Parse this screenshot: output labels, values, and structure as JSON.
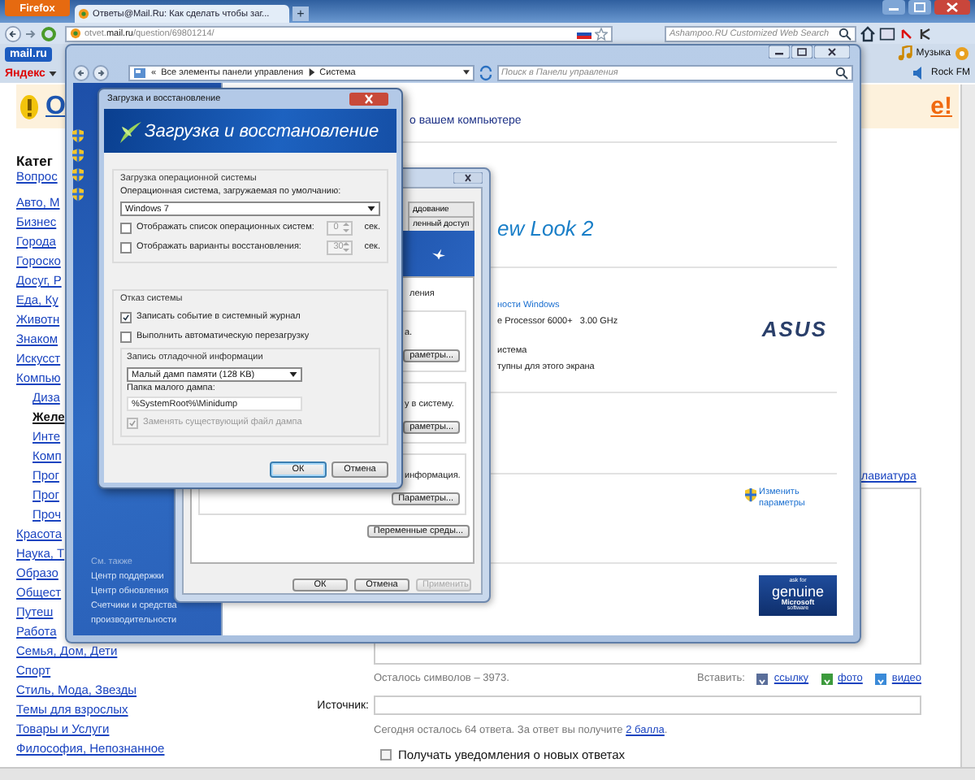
{
  "browser": {
    "menu_button": "Firefox",
    "tabs": [
      {
        "title": "Ответы@Mail.Ru: Как сделать чтобы заг...",
        "selected": true
      }
    ],
    "new_tab": "+",
    "url": "otvet.**mail.ru**/question/69801214/",
    "search_placeholder": "Ashampoo.RU Customized Web Search",
    "bookmarks_left": [
      "mail.ru",
      "Яндекс"
    ],
    "bookmarks_right": [
      "Музыка",
      "Rock FM"
    ]
  },
  "page": {
    "banner_link": "О",
    "banner_tail": "е!",
    "categories_heading": "Катег",
    "top_category": {
      "label": "Вопрос",
      "selected": false
    },
    "categories": [
      {
        "label": "Авто, М",
        "selected": false
      },
      {
        "label": "Бизнес",
        "selected": false
      },
      {
        "label": "Города",
        "selected": false
      },
      {
        "label": "Гороско",
        "selected": false
      },
      {
        "label": "Досуг, Р",
        "selected": false
      },
      {
        "label": "Еда, Ку",
        "selected": false
      },
      {
        "label": "Животн",
        "selected": false
      },
      {
        "label": "Знаком",
        "selected": false
      },
      {
        "label": "Искусст",
        "selected": false
      },
      {
        "label": "Компью",
        "selected": false,
        "children": [
          {
            "label": "Диза",
            "selected": false
          },
          {
            "label": "Желе",
            "selected": true
          },
          {
            "label": "Инте",
            "selected": false
          },
          {
            "label": "Комп",
            "selected": false
          },
          {
            "label": "Прог",
            "selected": false
          },
          {
            "label": "Прог",
            "selected": false
          },
          {
            "label": "Проч",
            "selected": false
          }
        ]
      },
      {
        "label": "Красота",
        "selected": false
      },
      {
        "label": "Наука, Т",
        "selected": false
      },
      {
        "label": "Образо",
        "selected": false
      },
      {
        "label": "Общест",
        "selected": false
      },
      {
        "label": "Путеш",
        "selected": false
      },
      {
        "label": "Работа",
        "selected": false
      },
      {
        "label": "Семья, Дом, Дети",
        "selected": false
      },
      {
        "label": "Спорт",
        "selected": false
      },
      {
        "label": "Стиль, Мода, Звезды",
        "selected": false
      },
      {
        "label": "Темы для взрослых",
        "selected": false
      },
      {
        "label": "Товары и Услуги",
        "selected": false
      },
      {
        "label": "Философия, Непознанное",
        "selected": false
      }
    ],
    "keyboard_link": "лавиатура",
    "chars_left": "Осталось символов – 3973.",
    "insert_label": "Вставить:",
    "insert_links": [
      {
        "kind": "link",
        "label": "ссылку"
      },
      {
        "kind": "photo",
        "label": "фото"
      },
      {
        "kind": "video",
        "label": "видео"
      }
    ],
    "source_label": "Источник:",
    "answers_note": {
      "before": "Сегодня осталось 64 ответа. За ответ вы получите ",
      "link": "2 балла",
      "after": "."
    },
    "notify": {
      "label": "Получать уведомления о новых ответах",
      "checked": false
    }
  },
  "control_panel": {
    "breadcrumb_prefix": "«",
    "breadcrumb": [
      "Все элементы панели управления",
      "Система"
    ],
    "search_placeholder": "Поиск в Панели управления",
    "see_also_heading": "См. также",
    "see_also": [
      "Центр поддержки",
      "Центр обновления",
      "Счетчики и средства производительности"
    ],
    "heading": "о вашем компьютере",
    "edition": "ew Look 2",
    "rating_link": "ности Windows",
    "processor": "e Processor 6000+   3.00 GHz",
    "system_type": "истема",
    "pen_touch": "тупны для этого экрана",
    "manufacturer_logo": "ASUS",
    "change_settings": "Изменить параметры",
    "genuine_badge": [
      "ask for",
      "genuine",
      "Microsoft",
      "software"
    ]
  },
  "system_properties": {
    "tabs": [
      {
        "label": "ддование",
        "selected": false
      },
      {
        "label": "ленный доступ",
        "selected": false
      }
    ],
    "intro": "ления",
    "sections": [
      {
        "text": "а.",
        "button": "раметры..."
      },
      {
        "text": "у в систему.",
        "button": "раметры..."
      },
      {
        "text": "информация.",
        "button": "Параметры..."
      }
    ],
    "env_button": "Переменные среды...",
    "buttons": [
      {
        "label": "ОК",
        "disabled": false
      },
      {
        "label": "Отмена",
        "disabled": false
      },
      {
        "label": "Применить",
        "disabled": true
      }
    ]
  },
  "boot_dialog": {
    "title": "Загрузка и восстановление",
    "banner": "Загрузка и восстановление",
    "startup": {
      "heading": "Загрузка операционной системы",
      "default_os_label": "Операционная система, загружаемая по умолчанию:",
      "default_os": "Windows 7",
      "options": [
        {
          "label": "Отображать список операционных систем:",
          "checked": false,
          "value": "0",
          "unit": "сек.",
          "disabled": true
        },
        {
          "label": "Отображать варианты восстановления:",
          "checked": false,
          "value": "30",
          "unit": "сек.",
          "disabled": true
        }
      ]
    },
    "failure": {
      "heading": "Отказ системы",
      "options": [
        {
          "label": "Записать событие в системный журнал",
          "checked": true
        },
        {
          "label": "Выполнить автоматическую перезагрузку",
          "checked": false
        }
      ],
      "debug_heading": "Запись отладочной информации",
      "debug_type": "Малый дамп памяти (128 KB)",
      "dump_folder_label": "Папка малого дампа:",
      "dump_folder": "%SystemRoot%\\Minidump",
      "overwrite": {
        "label": "Заменять существующий файл дампа",
        "checked": true,
        "disabled": true
      }
    },
    "buttons": [
      "ОК",
      "Отмена"
    ]
  }
}
